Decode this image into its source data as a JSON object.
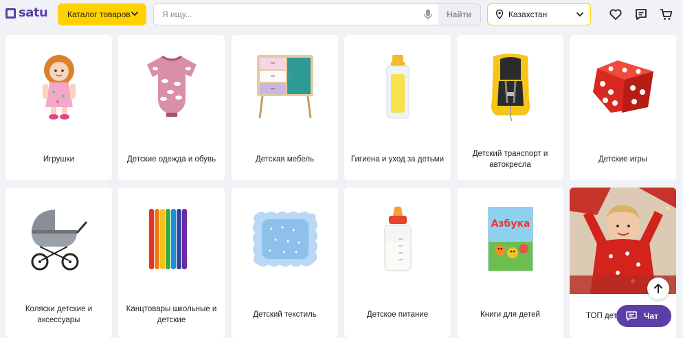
{
  "header": {
    "logo_text": "satu",
    "catalog_label": "Каталог товаров",
    "search_placeholder": "Я ищу...",
    "search_button": "Найти",
    "region": "Казахстан"
  },
  "colors": {
    "brand_purple": "#5a3fa8",
    "accent_yellow": "#ffd200",
    "background": "#f1f2f6"
  },
  "categories": [
    {
      "label": "Игрушки",
      "icon": "doll-image"
    },
    {
      "label": "Детские одежда и обувь",
      "icon": "baby-bodysuit-image"
    },
    {
      "label": "Детская мебель",
      "icon": "dresser-image"
    },
    {
      "label": "Гигиена и уход за детьми",
      "icon": "baby-lotion-bottle-image"
    },
    {
      "label": "Детский транспорт и автокресла",
      "icon": "car-seat-image"
    },
    {
      "label": "Детские игры",
      "icon": "dice-image"
    },
    {
      "label": "Коляски детские и аксессуары",
      "icon": "stroller-image"
    },
    {
      "label": "Канцтовары школьные и детские",
      "icon": "markers-image"
    },
    {
      "label": "Детский текстиль",
      "icon": "pillow-image"
    },
    {
      "label": "Детское питание",
      "icon": "baby-bottle-image"
    },
    {
      "label": "Книги для детей",
      "icon": "book-image"
    },
    {
      "label": "ТОП детс",
      "icon": "child-gift-photo"
    }
  ],
  "book_cover_text": "Азбука",
  "floating": {
    "chat_label": "Чат"
  }
}
